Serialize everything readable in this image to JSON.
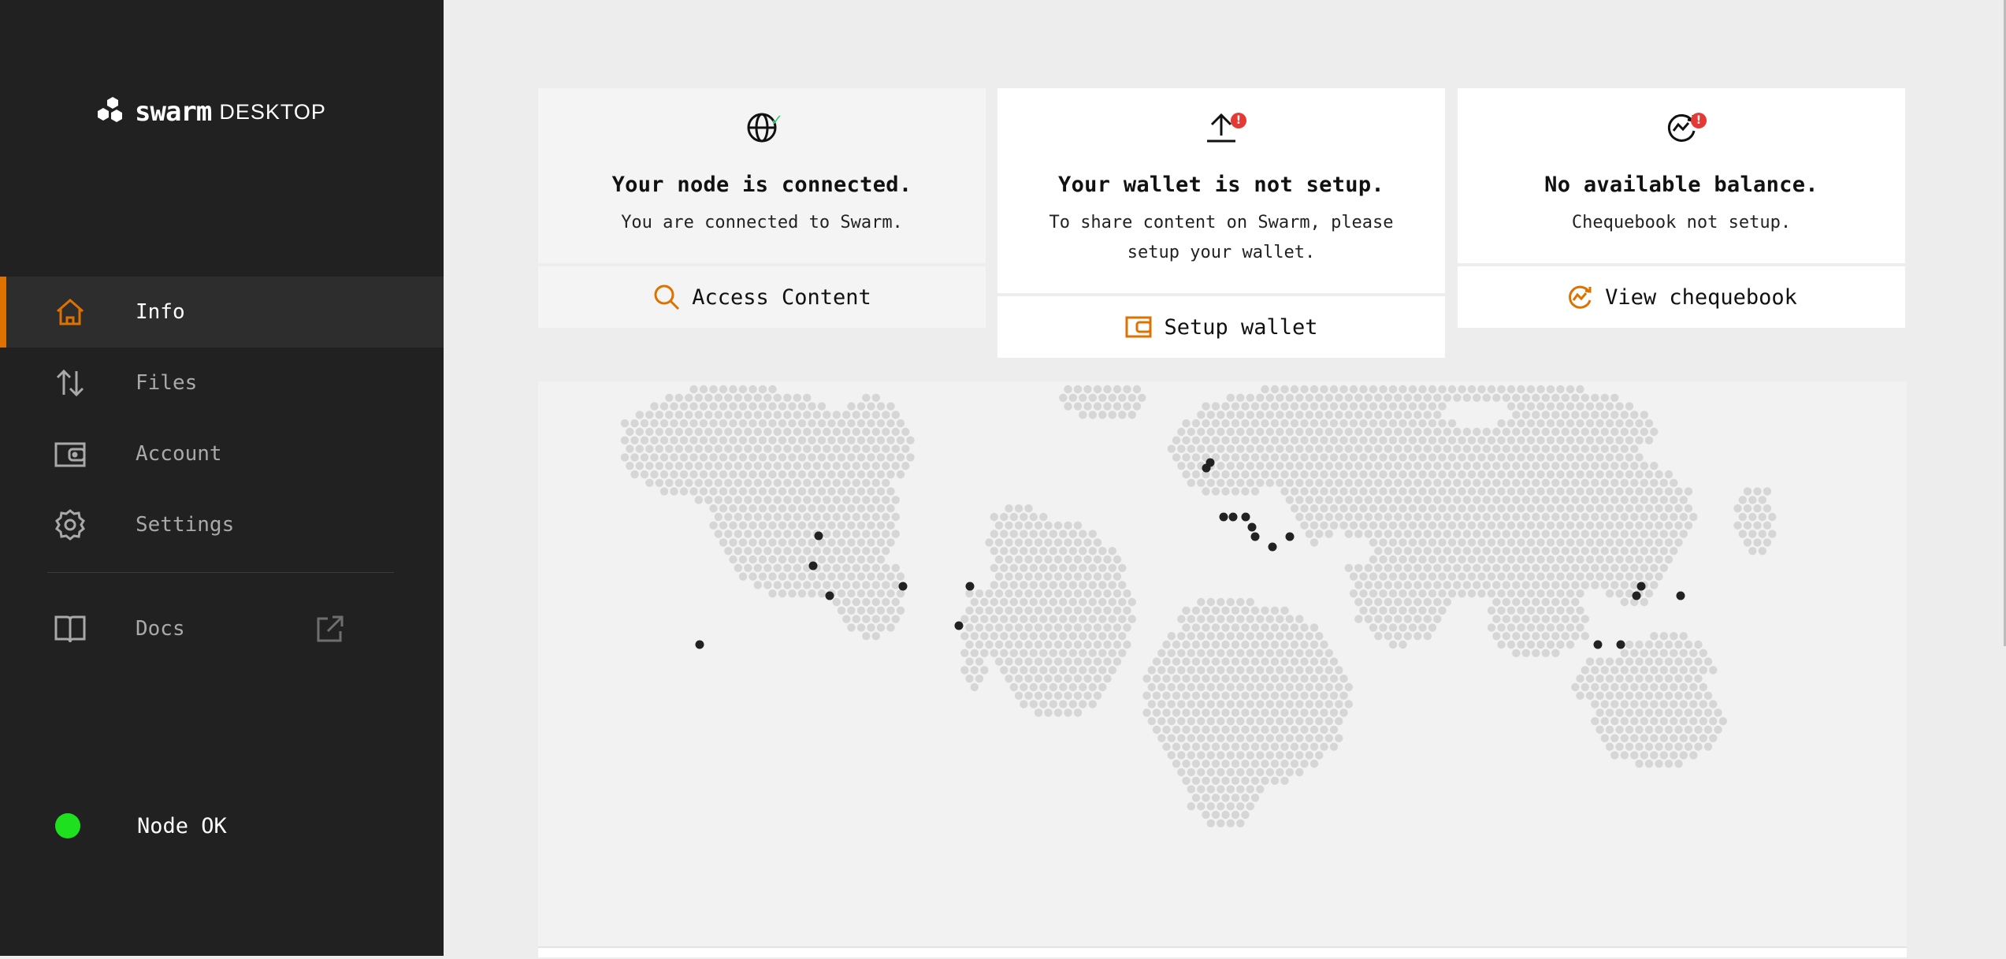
{
  "brand": {
    "name": "swarm",
    "suffix": "DESKTOP"
  },
  "nav": {
    "items": [
      {
        "label": "Info",
        "icon": "home-icon",
        "active": true
      },
      {
        "label": "Files",
        "icon": "arrows-up-down-icon",
        "active": false
      },
      {
        "label": "Account",
        "icon": "wallet-icon",
        "active": false
      },
      {
        "label": "Settings",
        "icon": "gear-icon",
        "active": false
      }
    ],
    "docs": {
      "label": "Docs",
      "icon": "book-icon",
      "external_icon": "external-link-icon"
    }
  },
  "status": {
    "label": "Node OK",
    "color": "#1fe01f"
  },
  "cards": [
    {
      "icon": "globe-icon",
      "indicator": "check",
      "title": "Your node is connected.",
      "subtitle": "You are connected to Swarm.",
      "action": "Access Content",
      "action_icon": "search-icon"
    },
    {
      "icon": "upload-icon",
      "indicator": "!",
      "title": "Your wallet is not setup.",
      "subtitle": "To share content on Swarm, please setup your wallet.",
      "action": "Setup wallet",
      "action_icon": "wallet-icon"
    },
    {
      "icon": "chequebook-icon",
      "indicator": "!",
      "title": "No available balance.",
      "subtitle": "Chequebook not setup.",
      "action": "View chequebook",
      "action_icon": "chequebook-icon"
    }
  ],
  "colors": {
    "accent": "#dd7200",
    "sidebar": "#212121",
    "error": "#e53935",
    "success": "#2ecc71"
  },
  "map": {
    "description_icon": "world-peer-map",
    "peer_count": 23
  }
}
